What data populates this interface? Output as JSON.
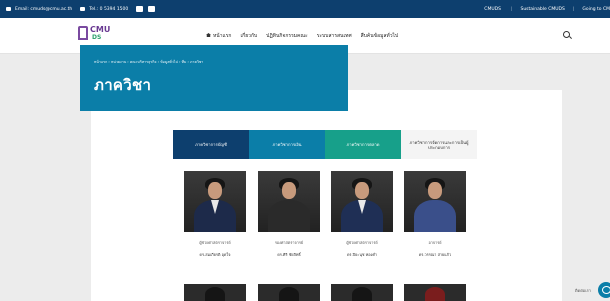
{
  "topbar": {
    "email": "Email: cmuds@cmu.ac.th",
    "tel": "Tel.: 0 5394 1500",
    "links": [
      "CMUDS",
      "Sustainable CMUDS",
      "Going to CM"
    ]
  },
  "header": {
    "logo_line1": "CMU",
    "logo_line2": "DS",
    "nav": [
      "หน้าแรก",
      "เกี่ยวกับ",
      "ปฏิทินกิจกรรมคณะ",
      "ระบบสารสนเทศ",
      "สืบค้นข้อมูลทั่วไป"
    ]
  },
  "hero": {
    "breadcrumb": "หน้าแรก › หน่วยงาน › คณะบริหารธุรกิจ › ข้อมูลทั่วไป › ทีม › ภาควิชา",
    "title": "ภาควิชา"
  },
  "tabs": [
    "ภาควิชาการบัญชี",
    "ภาควิชาการเงิน",
    "ภาควิชาการตลาด",
    "ภาควิชาการจัดการและการเป็นผู้ประกอบการ"
  ],
  "staff": [
    {
      "role": "ผู้ช่วยศาสตราจารย์",
      "name": "ดร.สมเกียรติ อุดใจ"
    },
    {
      "role": "รองศาสตราจารย์",
      "name": "ดร.ศิริ ชัยสิทธิ์"
    },
    {
      "role": "ผู้ช่วยศาสตราจารย์",
      "name": "ดร.ปิยะนุช ทองคำ"
    },
    {
      "role": "อาจารย์",
      "name": "ดร.วรรณา สายแก้ว"
    }
  ],
  "chat": {
    "label": "ติดต่อเรา"
  }
}
